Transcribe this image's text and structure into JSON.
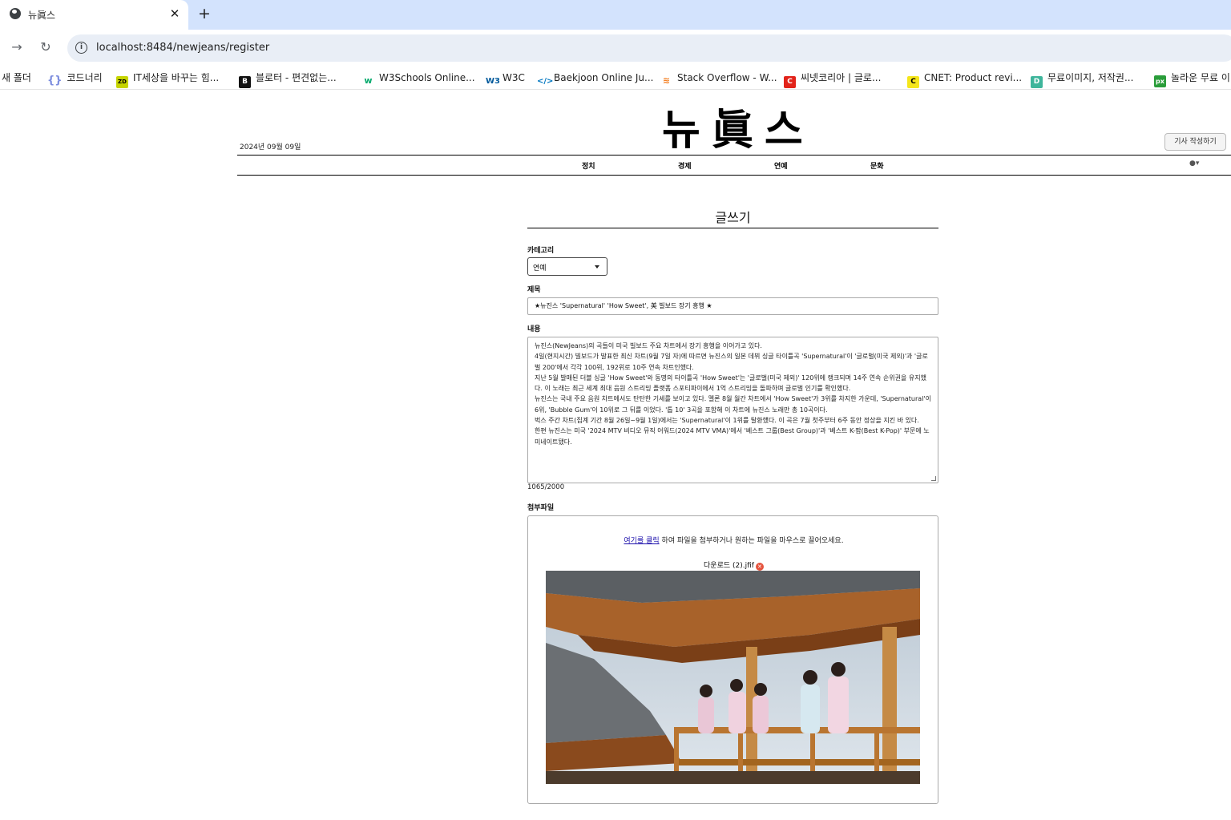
{
  "browser": {
    "tab_title": "뉴眞스",
    "url": "localhost:8484/newjeans/register",
    "bookmarks": [
      {
        "label": "새 폴더",
        "icon": "folder-icon"
      },
      {
        "label": "코드너리",
        "icon": "braces-icon"
      },
      {
        "label": "IT세상을 바꾸는 힘...",
        "icon": "zdnet-icon"
      },
      {
        "label": "블로터 - 편견없는...",
        "icon": "bloter-icon"
      },
      {
        "label": "W3Schools Online...",
        "icon": "w3schools-icon"
      },
      {
        "label": "W3C",
        "icon": "w3c-icon"
      },
      {
        "label": "Baekjoon Online Ju...",
        "icon": "code-icon"
      },
      {
        "label": "Stack Overflow - W...",
        "icon": "stackoverflow-icon"
      },
      {
        "label": "씨넷코리아 | 글로...",
        "icon": "cnet-korea-icon"
      },
      {
        "label": "CNET: Product revi...",
        "icon": "cnet-icon"
      },
      {
        "label": "무료이미지, 저작권...",
        "icon": "pixabay-icon"
      },
      {
        "label": "놀라운 무료 이",
        "icon": "pexels-icon"
      }
    ]
  },
  "header": {
    "date": "2024년 09월 09일",
    "logo": "뉴眞스",
    "write_button": "기사 작성하기",
    "nav": [
      "정치",
      "경제",
      "연예",
      "문화"
    ]
  },
  "form": {
    "heading": "글쓰기",
    "category_label": "카테고리",
    "category_value": "연예",
    "title_label": "제목",
    "title_value": "★뉴진스 'Supernatural' 'How Sweet', 美 빌보드 장기 흥행 ★",
    "content_label": "내용",
    "content_value": "뉴진스(NewJeans)의 곡들이 미국 빌보드 주요 차트에서 장기 흥행을 이어가고 있다.\n4일(현지시간) 빌보드가 발표한 최신 차트(9월 7일 자)에 따르면 뉴진스의 일본 데뷔 싱글 타이틀곡 'Supernatural'이 '글로벌(미국 제외)'과 '글로벌 200'에서 각각 100위, 192위로 10주 연속 차트인했다.\n지난 5월 발매된 더블 싱글 'How Sweet'와 동명의 타이틀곡 'How Sweet'는 '글로벌(미국 제외)' 120위에 랭크되며 14주 연속 순위권을 유지했다. 이 노래는 최근 세계 최대 음원 스트리밍 플랫폼 스포티파이에서 1억 스트리밍을 돌파하며 글로벌 인기를 확인했다.\n뉴진스는 국내 주요 음원 차트에서도 탄탄한 기세를 보이고 있다. 멜론 8월 월간 차트에서 'How Sweet'가 3위를 차지한 가운데, 'Supernatural'이 6위, 'Bubble Gum'이 10위로 그 뒤를 이었다. '톱 10' 3곡을 포함해 이 차트에 뉴진스 노래만 총 10곡이다.\n벅스 주간 차트(집계 기간 8월 26일~9월 1일)에서는 'Supernatural'이 1위를 탈환했다. 이 곡은 7월 첫주부터 6주 동안 정상을 지킨 바 있다.\n한편 뉴진스는 미국 '2024 MTV 비디오 뮤직 어워드(2024 MTV VMA)'에서 '베스트 그룹(Best Group)'과 '베스트 K-팝(Best K-Pop)' 부문에 노미네이트됐다.",
    "char_count": "1065/2000",
    "attachment_label": "첨부파일",
    "dropzone_link": "여기를 클릭",
    "dropzone_text": " 하여 파일을 첨부하거나 원하는 파일을 마우스로 끌어오세요.",
    "file_name": "다운로드 (2).jfif"
  },
  "colors": {
    "tabstrip": "#d3e3fd",
    "omnibox": "#e9eef6",
    "link": "#1a0dab",
    "remove": "#e5533d"
  }
}
